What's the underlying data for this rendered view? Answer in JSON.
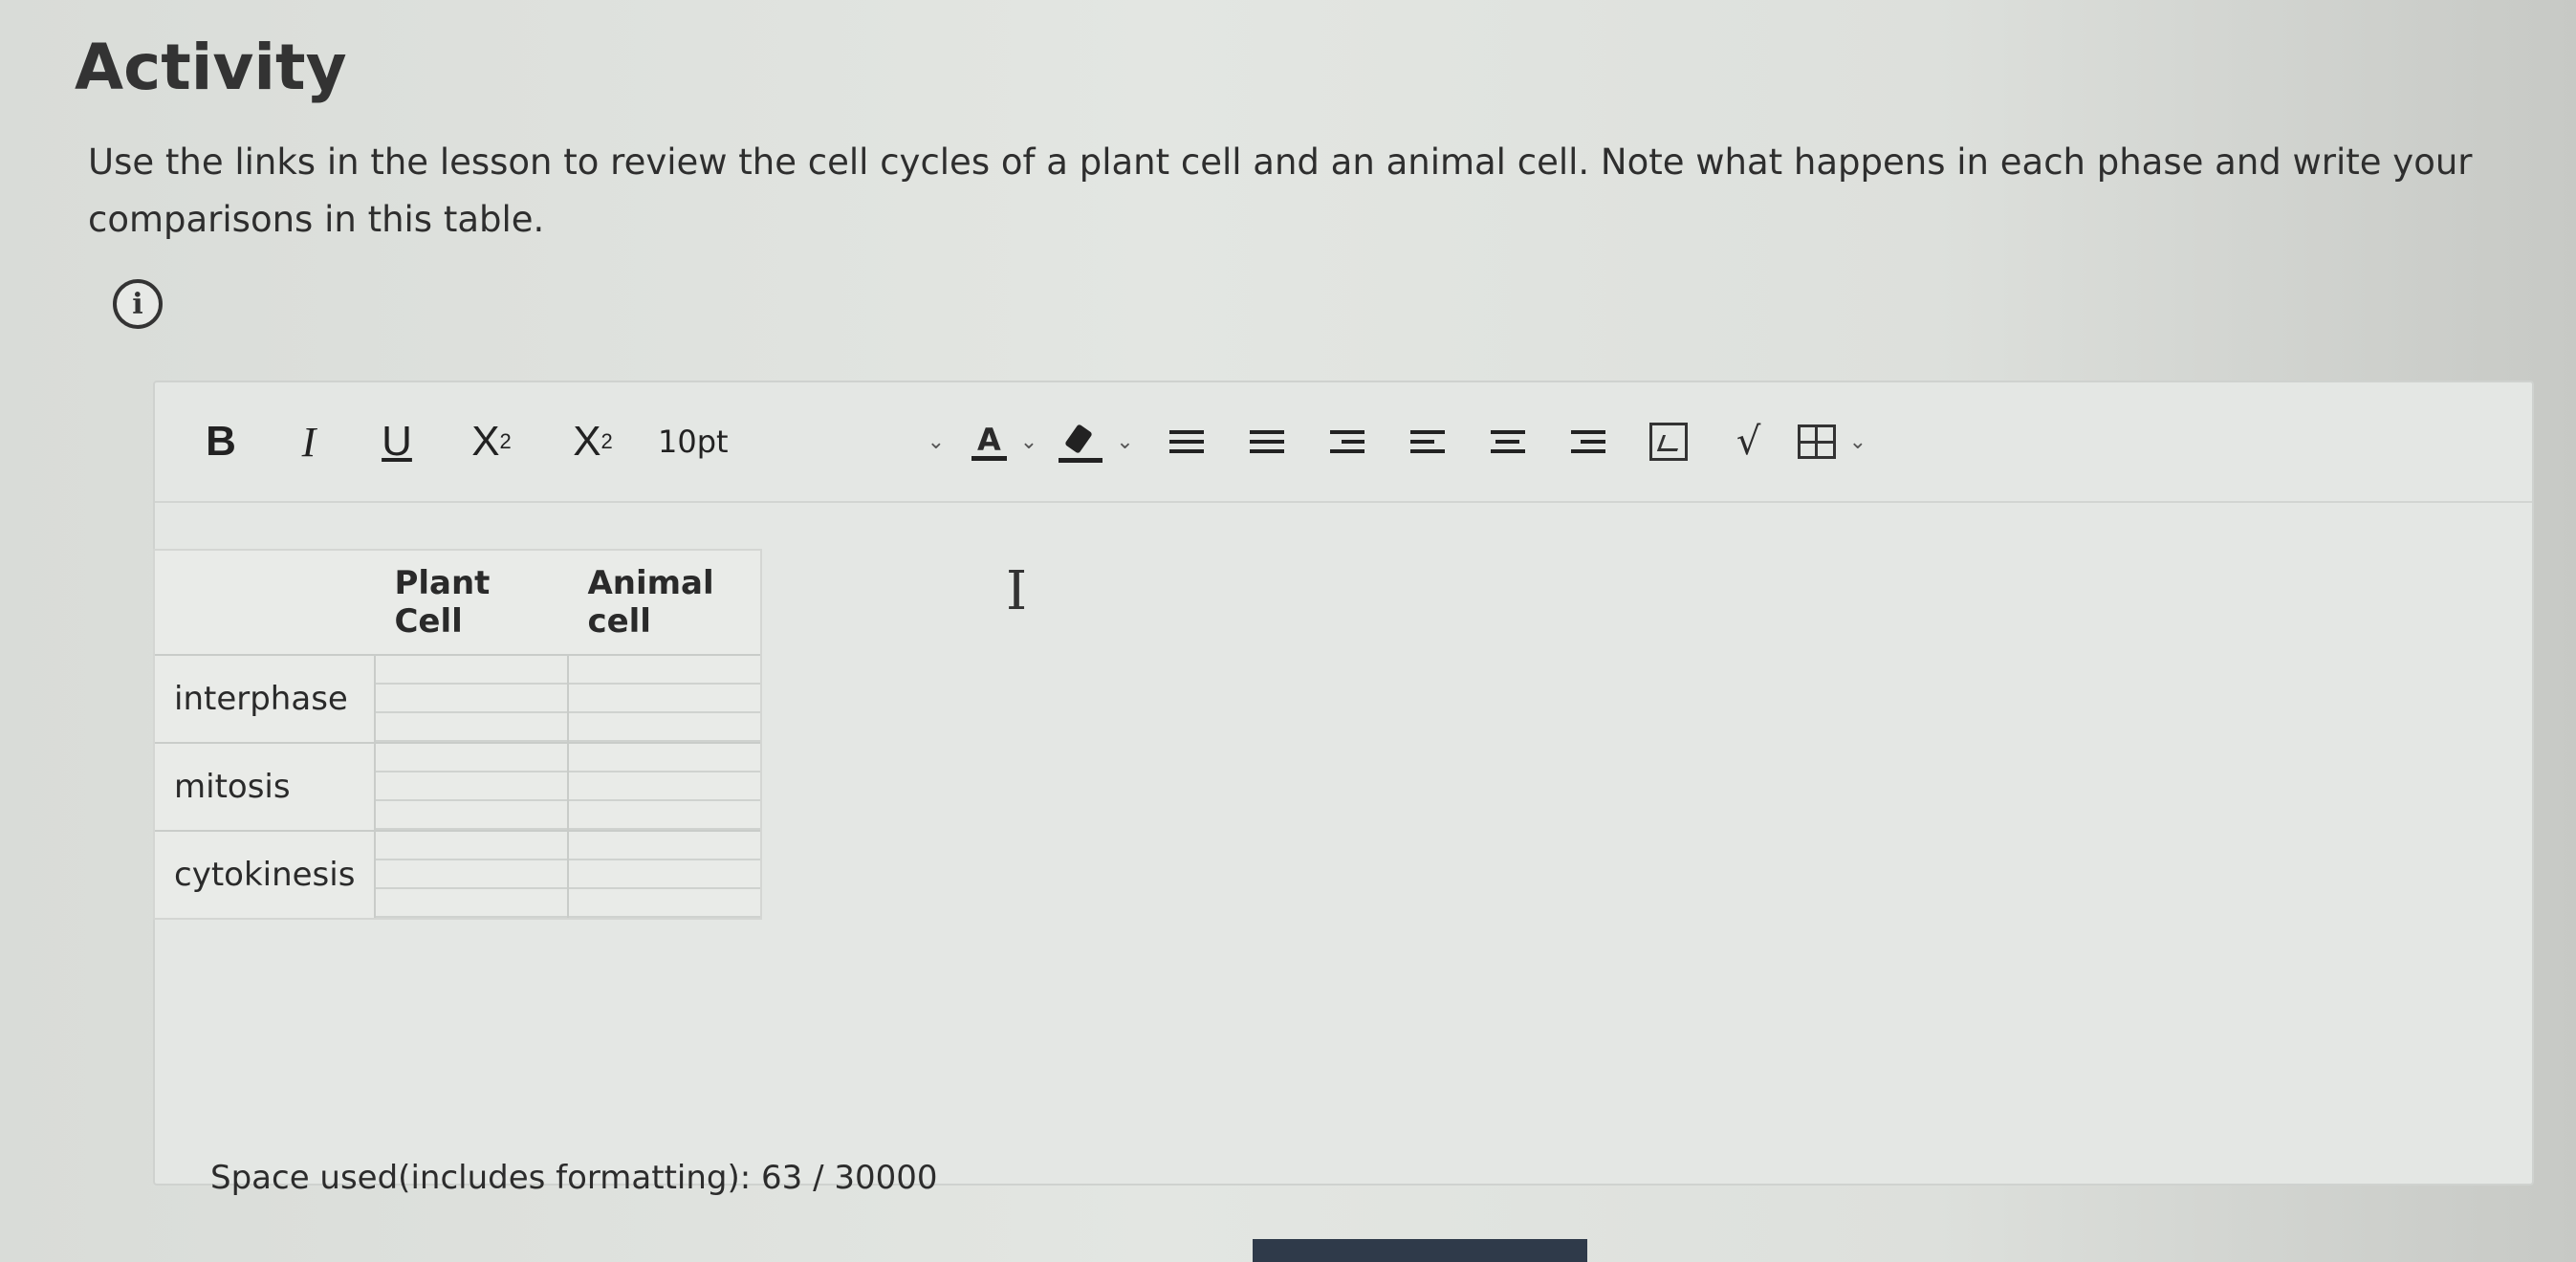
{
  "activity": {
    "title": "Activity",
    "instructions": "Use the links in the lesson to review the cell cycles of a plant cell and an animal cell. Note what happens in each phase and write your comparisons in this table."
  },
  "toolbar": {
    "bold": "B",
    "italic": "I",
    "underline": "U",
    "superscript_base": "X",
    "superscript_mark": "2",
    "subscript_base": "X",
    "subscript_mark": "2",
    "font_size": "10pt",
    "font_color_label": "A",
    "sqrt_label": "√"
  },
  "table": {
    "headers": [
      "",
      "Plant Cell",
      "Animal cell"
    ],
    "rows": [
      {
        "label": "interphase",
        "plant": "",
        "animal": ""
      },
      {
        "label": "mitosis",
        "plant": "",
        "animal": ""
      },
      {
        "label": "cytokinesis",
        "plant": "",
        "animal": ""
      }
    ]
  },
  "footer": {
    "space_used": "Space used(includes formatting): 63 / 30000"
  },
  "colors": {
    "background": "#e3e6e2",
    "text": "#2b2b2b",
    "button_dark": "#2f3a4a"
  }
}
